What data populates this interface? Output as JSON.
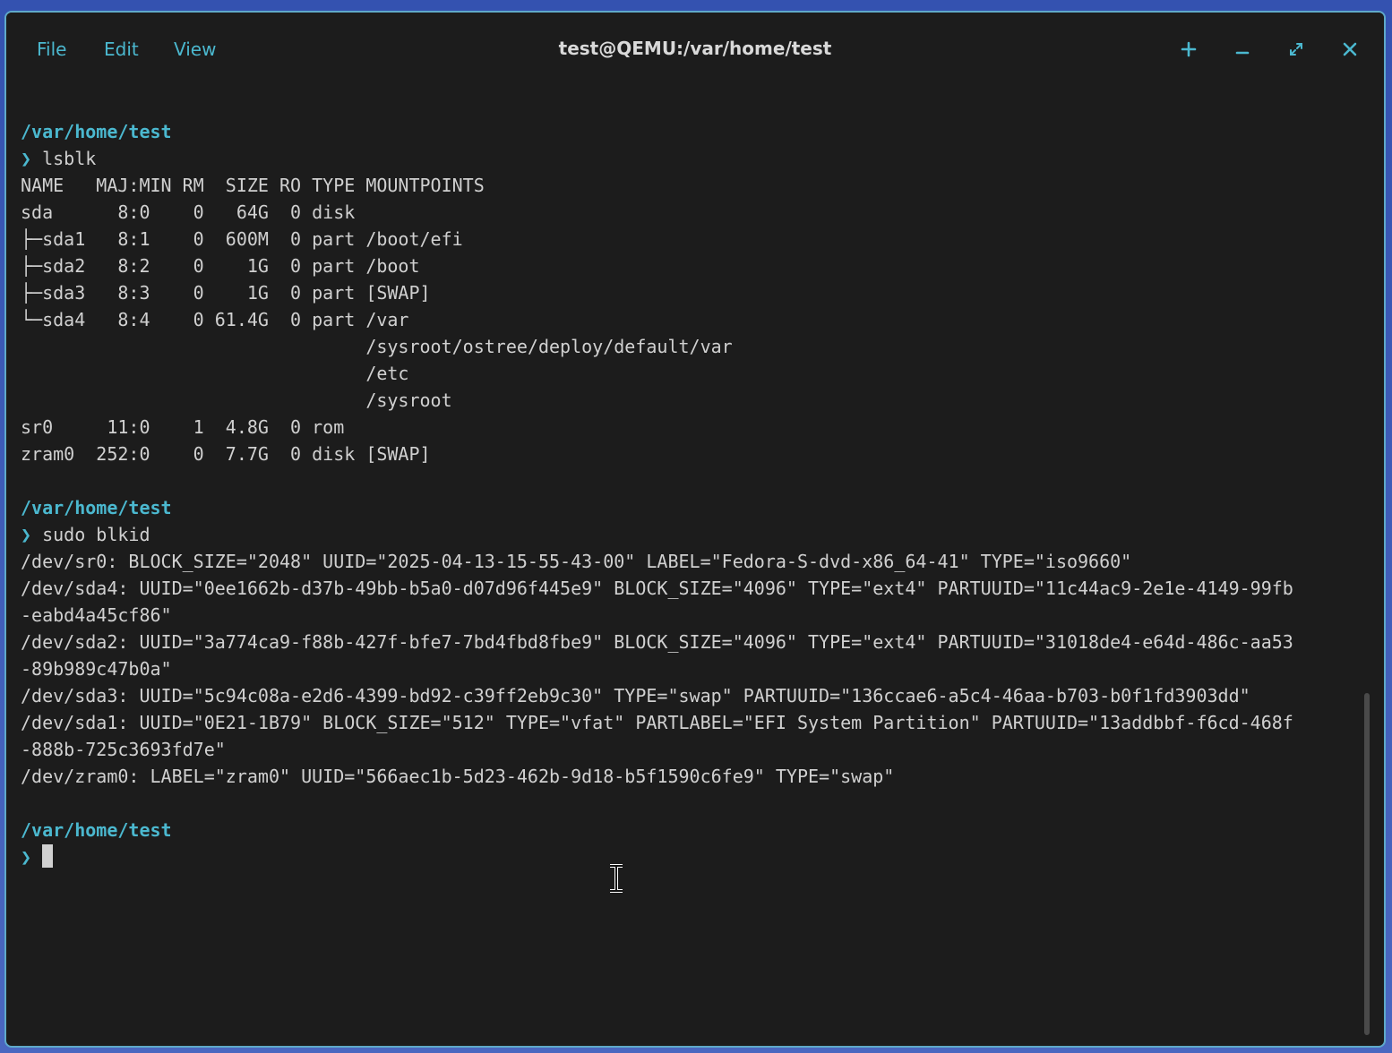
{
  "window": {
    "title": "test@QEMU:/var/home/test",
    "menu": [
      "File",
      "Edit",
      "View"
    ],
    "controls": [
      "new-tab",
      "minimize",
      "maximize",
      "close"
    ]
  },
  "colors": {
    "accent": "#4bb8cf",
    "background": "#1c1c1c",
    "text": "#d0d0d0",
    "border": "#5fa9c9"
  },
  "terminal": {
    "prompt_symbol": "❯",
    "blocks": [
      {
        "cwd": "/var/home/test",
        "command": "lsblk",
        "output": [
          "NAME   MAJ:MIN RM  SIZE RO TYPE MOUNTPOINTS",
          "sda      8:0    0   64G  0 disk",
          "├─sda1   8:1    0  600M  0 part /boot/efi",
          "├─sda2   8:2    0    1G  0 part /boot",
          "├─sda3   8:3    0    1G  0 part [SWAP]",
          "└─sda4   8:4    0 61.4G  0 part /var",
          "                                /sysroot/ostree/deploy/default/var",
          "                                /etc",
          "                                /sysroot",
          "sr0     11:0    1  4.8G  0 rom",
          "zram0  252:0    0  7.7G  0 disk [SWAP]"
        ]
      },
      {
        "cwd": "/var/home/test",
        "command": "sudo blkid",
        "output": [
          "/dev/sr0: BLOCK_SIZE=\"2048\" UUID=\"2025-04-13-15-55-43-00\" LABEL=\"Fedora-S-dvd-x86_64-41\" TYPE=\"iso9660\"",
          "/dev/sda4: UUID=\"0ee1662b-d37b-49bb-b5a0-d07d96f445e9\" BLOCK_SIZE=\"4096\" TYPE=\"ext4\" PARTUUID=\"11c44ac9-2e1e-4149-99fb",
          "-eabd4a45cf86\"",
          "/dev/sda2: UUID=\"3a774ca9-f88b-427f-bfe7-7bd4fbd8fbe9\" BLOCK_SIZE=\"4096\" TYPE=\"ext4\" PARTUUID=\"31018de4-e64d-486c-aa53",
          "-89b989c47b0a\"",
          "/dev/sda3: UUID=\"5c94c08a-e2d6-4399-bd92-c39ff2eb9c30\" TYPE=\"swap\" PARTUUID=\"136ccae6-a5c4-46aa-b703-b0f1fd3903dd\"",
          "/dev/sda1: UUID=\"0E21-1B79\" BLOCK_SIZE=\"512\" TYPE=\"vfat\" PARTLABEL=\"EFI System Partition\" PARTUUID=\"13addbbf-f6cd-468f",
          "-888b-725c3693fd7e\"",
          "/dev/zram0: LABEL=\"zram0\" UUID=\"566aec1b-5d23-462b-9d18-b5f1590c6fe9\" TYPE=\"swap\""
        ]
      }
    ],
    "current_cwd": "/var/home/test",
    "current_input": ""
  }
}
